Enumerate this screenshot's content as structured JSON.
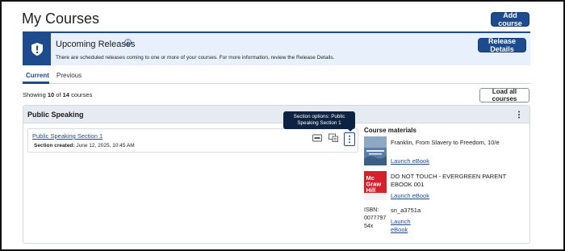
{
  "page": {
    "title": "My Courses"
  },
  "header": {
    "add_course_label": "Add course"
  },
  "banner": {
    "title": "Upcoming Releases",
    "text": "There are scheduled releases coming to one or more of your courses. For more information, review the Release Details.",
    "button_label": "Release Details"
  },
  "tabs": [
    {
      "label": "Current",
      "active": true
    },
    {
      "label": "Previous",
      "active": false
    }
  ],
  "summary": {
    "prefix": "Showing ",
    "shown": "10",
    "of": " of ",
    "total": "14",
    "suffix": " courses",
    "load_all_label": "Load all courses"
  },
  "course": {
    "title": "Public Speaking",
    "section": {
      "name": "Public Speaking Section 1",
      "created_label": "Section created:",
      "created_value": " June 12, 2025, 10:45 AM",
      "tooltip": "Section options: Public Speaking Section 1"
    },
    "materials": {
      "heading": "Course materials",
      "items": [
        {
          "title": "Franklin, From Slavery to Freedom, 10/e",
          "link": "Launch eBook"
        },
        {
          "title": "DO NOT TOUCH - EVERGREEN PARENT EBOOK 001",
          "link": "Launch eBook",
          "cover_text": "Mc Graw Hill"
        },
        {
          "title": "sn_a3751a",
          "link": "Launch eBook",
          "isbn_alt": "ISBN: 0077797 54x"
        }
      ]
    }
  },
  "colors": {
    "brand": "#1e4b8e",
    "banner_bg": "#e8f1fb",
    "tooltip_bg": "#0e2341",
    "mh_red": "#d6202a"
  },
  "icons": [
    "alert-shield-icon",
    "info-icon",
    "kebab-icon",
    "lms-icon",
    "ebook-icon"
  ]
}
